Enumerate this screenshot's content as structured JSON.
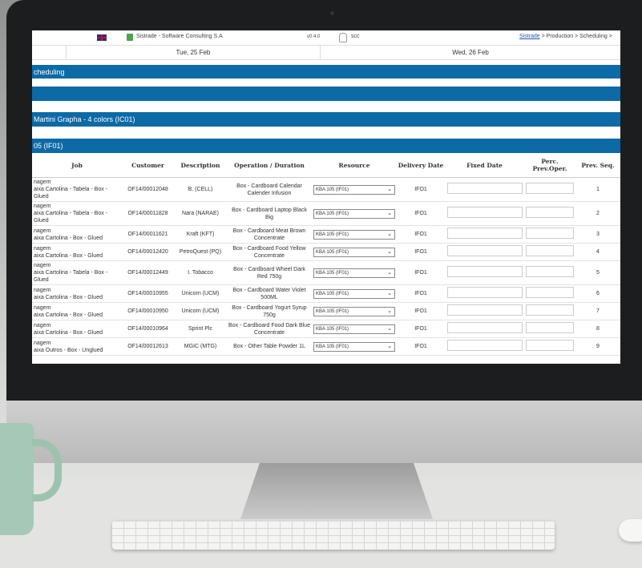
{
  "topbar": {
    "app_title": "Sistrade - Software Consulting S.A",
    "version": "v0.4.0",
    "user": "scc",
    "breadcrumb_link": "Sistrade",
    "breadcrumb_rest": " > Production > Scheduling > "
  },
  "dates": [
    "Tue, 25 Feb",
    "Wed, 26 Feb"
  ],
  "sections": {
    "scheduling": "cheduling",
    "section2": "",
    "machine": "Martini Grapha - 4 colors (IC01)",
    "resource": "05 (IF01)"
  },
  "columns": [
    "Job",
    "Customer",
    "Description",
    "Operation / Duration",
    "Resource",
    "Delivery Date",
    "Fixed Date",
    "Perc. Prev.Oper.",
    "Prev. Seq."
  ],
  "rows": [
    {
      "job": "nagem\naixa Cartolina - Tabela - Box - Glued",
      "customer": "OF14/00012048",
      "description": "B. (CELL)",
      "operation": "Box - Cardboard Calendar Calender Infusion",
      "resource": "KBA 105 (IF01)",
      "delivery": "IFO1",
      "seq": "1"
    },
    {
      "job": "nagem\naixa Cartolina - Tabela - Box - Glued",
      "customer": "OF14/00011828",
      "description": "Nara (NARAE)",
      "operation": "Box - Cardboard Laptop Black Big",
      "resource": "KBA 105 (IF01)",
      "delivery": "IFO1",
      "seq": "2"
    },
    {
      "job": "nagem\naixa Cartolina - Box - Glued",
      "customer": "OF14/00011621",
      "description": "Kraft (KFT)",
      "operation": "Box - Cardboard Meat Brown Concentrate",
      "resource": "KBA 105 (IF01)",
      "delivery": "IFO1",
      "seq": "3"
    },
    {
      "job": "nagem\naixa Cartolina - Box - Glued",
      "customer": "OF14/00012420",
      "description": "PetroQuest (PQ)",
      "operation": "Box - Cardboard Food Yellow Concentrate",
      "resource": "KBA 105 (IF01)",
      "delivery": "IFO1",
      "seq": "4"
    },
    {
      "job": "nagem\naixa Cartolina - Tabela - Box - Glued",
      "customer": "OF14/00012449",
      "description": "I. Tobacco",
      "operation": "Box - Cardboard Wheel Dark Red 750g",
      "resource": "KBA 105 (IF01)",
      "delivery": "IFO1",
      "seq": "5"
    },
    {
      "job": "nagem\naixa Cartolina - Box - Glued",
      "customer": "OF14/00010955",
      "description": "Unicorn (UCM)",
      "operation": "Box - Cardboard Water Violet 500ML",
      "resource": "KBA 105 (IF01)",
      "delivery": "IFO1",
      "seq": "6"
    },
    {
      "job": "nagem\naixa Cartolina - Box - Glued",
      "customer": "OF14/00010950",
      "description": "Unicorn (UCM)",
      "operation": "Box - Cardboard Yogurt Syrup 750g",
      "resource": "KBA 105 (IF01)",
      "delivery": "IFO1",
      "seq": "7"
    },
    {
      "job": "nagem\naixa Cartolina - Box - Glued",
      "customer": "OF14/00010964",
      "description": "Sprint Plc",
      "operation": "Box - Cardboard Food Dark Blue Concentrate",
      "resource": "KBA 105 (IF01)",
      "delivery": "IFO1",
      "seq": "8"
    },
    {
      "job": "nagem\naixa Outros - Box - Unglued",
      "customer": "OF14/00012613",
      "description": "MGIC (MTG)",
      "operation": "Box - Other Table Powder 1L",
      "resource": "KBA 105 (IF01)",
      "delivery": "IFO1",
      "seq": "9"
    }
  ]
}
